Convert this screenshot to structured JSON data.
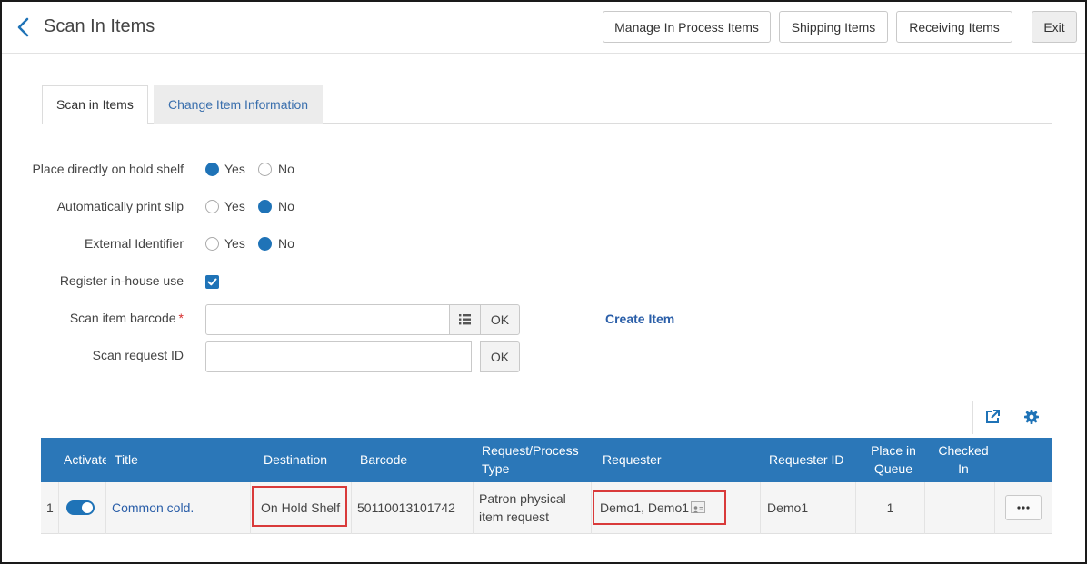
{
  "header": {
    "title": "Scan In Items",
    "buttons": {
      "manage_in_process": "Manage In Process Items",
      "shipping": "Shipping Items",
      "receiving": "Receiving Items",
      "exit": "Exit"
    }
  },
  "tabs": [
    {
      "label": "Scan in Items",
      "active": true
    },
    {
      "label": "Change Item Information",
      "active": false
    }
  ],
  "form": {
    "hold_shelf": {
      "label": "Place directly on hold shelf",
      "yes": "Yes",
      "no": "No",
      "selected": "Yes"
    },
    "print_slip": {
      "label": "Automatically print slip",
      "yes": "Yes",
      "no": "No",
      "selected": "No"
    },
    "external_id": {
      "label": "External Identifier",
      "yes": "Yes",
      "no": "No",
      "selected": "No"
    },
    "in_house": {
      "label": "Register in-house use",
      "checked": true
    },
    "barcode": {
      "label": "Scan item barcode",
      "required_mark": "*",
      "value": "",
      "ok": "OK"
    },
    "request_id": {
      "label": "Scan request ID",
      "value": "",
      "ok": "OK"
    },
    "create_item": "Create Item"
  },
  "table": {
    "columns": [
      "Activate",
      "Title",
      "Destination",
      "Barcode",
      "Request/Process Type",
      "Requester",
      "Requester ID",
      "Place in Queue",
      "Checked In"
    ],
    "rows": [
      {
        "index": "1",
        "active": true,
        "title": "Common cold.",
        "destination": "On Hold Shelf",
        "barcode": "50110013101742",
        "request_type_line1": "Patron physical",
        "request_type_line2": "item request",
        "requester": "Demo1, Demo1",
        "requester_id": "Demo1",
        "place_in_queue": "1",
        "checked_in": ""
      }
    ],
    "col_labels": {
      "activate": "Activate",
      "title": "Title",
      "destination": "Destination",
      "barcode": "Barcode",
      "request_type_1": "Request/Process",
      "request_type_2": "Type",
      "requester": "Requester",
      "requester_id": "Requester ID",
      "place_1": "Place in",
      "place_2": "Queue",
      "checked_1": "Checked",
      "checked_2": "In"
    }
  },
  "colors": {
    "accent": "#1f73b7",
    "table_header": "#2b77b8",
    "link": "#2a5ea8",
    "highlight": "#d93a3a"
  },
  "icons": [
    "chevron-left-icon",
    "list-icon",
    "export-icon",
    "gear-icon",
    "contact-card-icon",
    "more-options-icon"
  ]
}
